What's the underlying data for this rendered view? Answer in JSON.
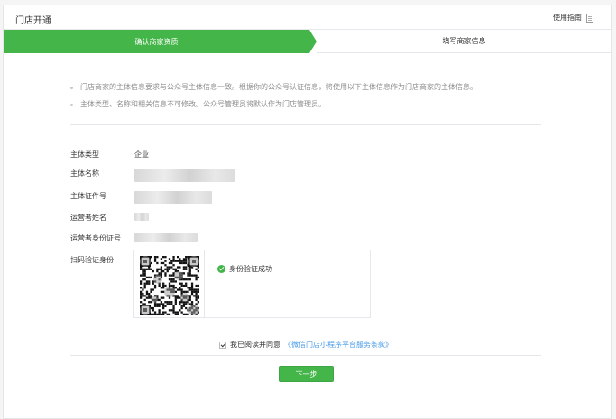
{
  "header": {
    "title": "门店开通",
    "guide_label": "使用指南"
  },
  "steps": [
    {
      "label": "确认商家资质",
      "active": true
    },
    {
      "label": "填写商家信息",
      "active": false
    }
  ],
  "notes": [
    "门店商家的主体信息要求与公众号主体信息一致。根据你的公众号认证信息，将使用以下主体信息作为门店商家的主体信息。",
    "主体类型、名称和相关信息不可修改。公众号管理员将默认作为门店管理员。"
  ],
  "fields": {
    "entity_type": {
      "label": "主体类型",
      "value": "企业"
    },
    "entity_name": {
      "label": "主体名称"
    },
    "entity_id": {
      "label": "主体证件号"
    },
    "operator_name": {
      "label": "运营者姓名"
    },
    "operator_id": {
      "label": "运营者身份证号"
    },
    "scan_verify": {
      "label": "扫码验证身份"
    }
  },
  "verification": {
    "status": "身份验证成功"
  },
  "agreement": {
    "text": "我已阅读并同意",
    "link": "《微信门店小程序平台服务条款》",
    "checked": true
  },
  "next_button": {
    "label": "下一步"
  },
  "colors": {
    "primary": "#44b549",
    "link": "#459ae9",
    "border": "#e7e7eb",
    "muted": "#8d8d8d"
  }
}
